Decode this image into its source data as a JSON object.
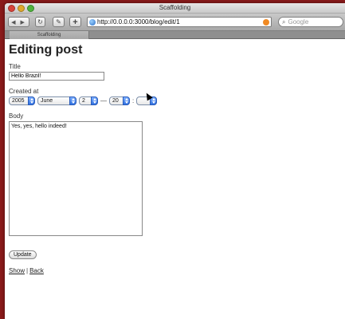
{
  "window": {
    "title": "Scaffolding"
  },
  "toolbar": {
    "back_icon": "back-forward-arrows",
    "url": "http://0.0.0.0:3000/blog/edit/1",
    "search_placeholder": "Google"
  },
  "tab": {
    "label": "Scaffolding"
  },
  "page": {
    "heading": "Editing post",
    "title_label": "Title",
    "title_value": "Hello Brazil!",
    "created_label": "Created at",
    "year": "2005",
    "month": "June",
    "day": "2",
    "dash": "—",
    "hour": "20",
    "colon": ":",
    "minute": "",
    "body_label": "Body",
    "body_value": "Yes, yes, hello indeed!",
    "update_button": "Update",
    "show_link": "Show",
    "separator": "|",
    "back_link": "Back"
  },
  "colors": {
    "desktop_bg": "#8a1a1a",
    "select_arrow": "#2f6fe0"
  }
}
